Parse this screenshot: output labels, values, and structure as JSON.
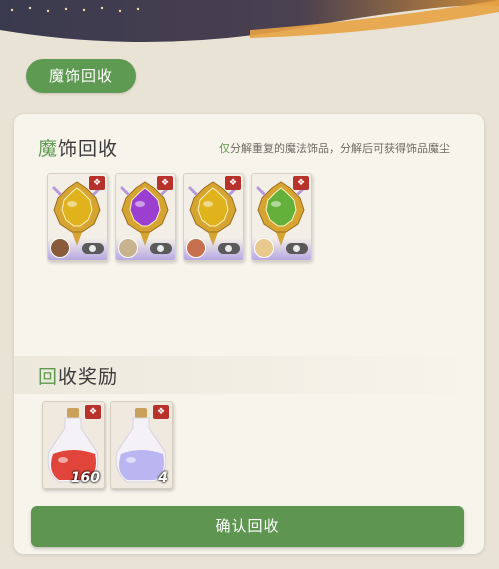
{
  "header": {
    "tab_label": "魔饰回收"
  },
  "recycle_section": {
    "title_first_char": "魔",
    "title_rest": "饰回收",
    "hint_first_char": "仅",
    "hint_rest": "分解重复的魔法饰品，分解后可获得饰品魔尘",
    "items": [
      {
        "gem_color": "#e0b21c",
        "emblem_color": "#d6a431"
      },
      {
        "gem_color": "#9b3fd1",
        "emblem_color": "#d6a431"
      },
      {
        "gem_color": "#e0b21c",
        "emblem_color": "#d6a431"
      },
      {
        "gem_color": "#63b13a",
        "emblem_color": "#d6a431"
      }
    ]
  },
  "reward_section": {
    "title_first_char": "回",
    "title_rest": "收奖励",
    "rewards": [
      {
        "count": "160",
        "liquid_color": "#e0443a"
      },
      {
        "count": "4",
        "liquid_color": "#b9b6f2"
      }
    ]
  },
  "confirm_button": {
    "label": "确认回收"
  },
  "colors": {
    "accent_green": "#5e9a4f",
    "badge_red": "#b8322c"
  }
}
